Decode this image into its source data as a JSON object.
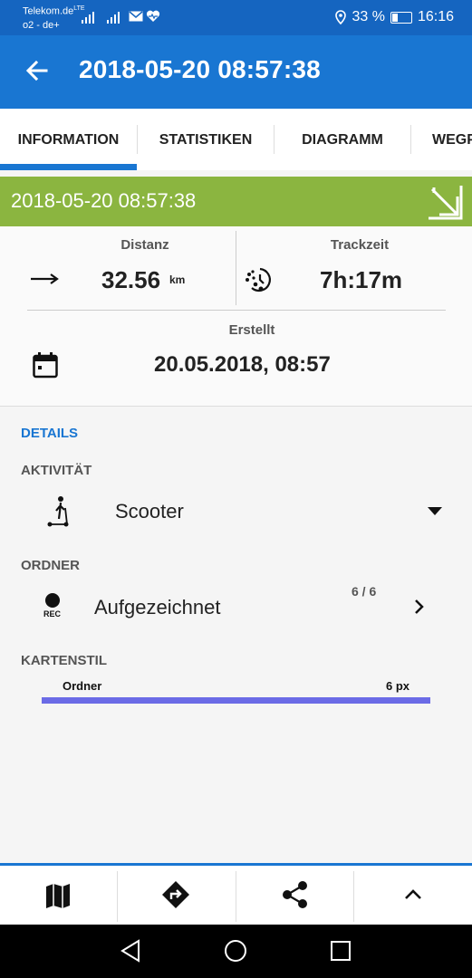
{
  "status_bar": {
    "carrier_primary": "Telekom.de",
    "network_type": "LTE",
    "carrier_secondary": "o2 - de+",
    "battery_percent": "33 %",
    "battery_level": 0.33,
    "time": "16:16"
  },
  "app_bar": {
    "title": "2018-05-20 08:57:38",
    "back_icon": "arrow-back-icon"
  },
  "tabs": [
    {
      "label": "INFORMATION",
      "selected": true
    },
    {
      "label": "STATISTIKEN",
      "selected": false
    },
    {
      "label": "DIAGRAMM",
      "selected": false
    },
    {
      "label": "WEGP",
      "selected": false
    }
  ],
  "header_bar": {
    "title": "2018-05-20 08:57:38",
    "color": "#8bb540"
  },
  "summary": {
    "distance_label": "Distanz",
    "distance_value": "32.56",
    "distance_unit": "km",
    "tracktime_label": "Trackzeit",
    "tracktime_value": "7h:17m",
    "created_label": "Erstellt",
    "created_value": "20.05.2018, 08:57"
  },
  "details": {
    "section_title": "DETAILS",
    "activity_label": "AKTIVITÄT",
    "activity_value": "Scooter",
    "folder_label": "ORDNER",
    "folder_value": "Aufgezeichnet",
    "folder_count": "6 / 6",
    "rec_label": "REC",
    "map_style_label": "KARTENSTIL",
    "line_name": "Ordner",
    "line_width": "6 px",
    "line_color": "#6b6be6"
  },
  "colors": {
    "primary": "#1976d2",
    "status_bar": "#1565c0",
    "accent_green": "#8bb540"
  },
  "bottom_nav": [
    {
      "icon": "map-icon"
    },
    {
      "icon": "directions-icon"
    },
    {
      "icon": "share-icon"
    },
    {
      "icon": "chevron-up-icon"
    }
  ]
}
